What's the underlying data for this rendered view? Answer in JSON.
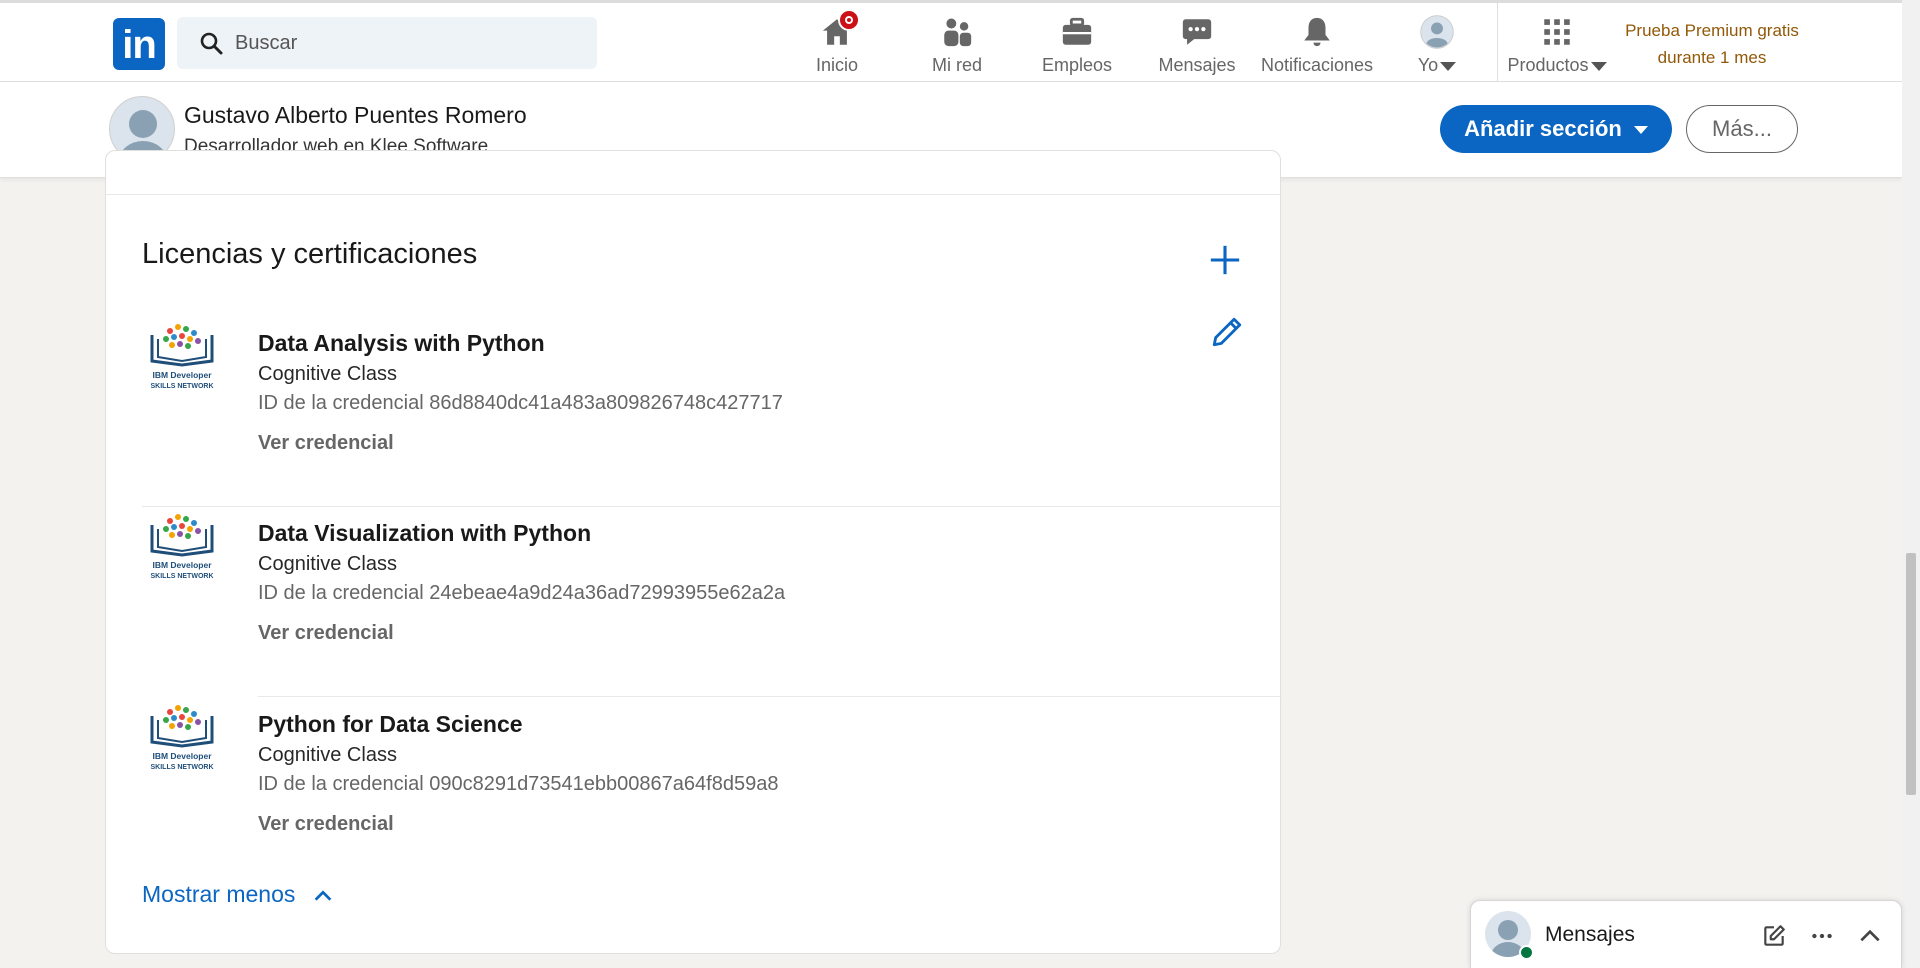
{
  "nav": {
    "search_placeholder": "Buscar",
    "items": [
      {
        "label": "Inicio",
        "icon": "home-icon"
      },
      {
        "label": "Mi red",
        "icon": "network-icon"
      },
      {
        "label": "Empleos",
        "icon": "briefcase-icon"
      },
      {
        "label": "Mensajes",
        "icon": "messaging-icon"
      },
      {
        "label": "Notificaciones",
        "icon": "bell-icon"
      },
      {
        "label": "Yo",
        "icon": "avatar"
      },
      {
        "label": "Productos",
        "icon": "grid-icon"
      }
    ],
    "premium_line1": "Prueba Premium gratis",
    "premium_line2": "durante 1 mes"
  },
  "profile": {
    "name": "Gustavo Alberto Puentes Romero",
    "headline": "Desarrollador web en Klee Software",
    "add_section_label": "Añadir sección",
    "more_label": "Más..."
  },
  "section": {
    "title": "Licencias y certificaciones",
    "certs": [
      {
        "title": "Data Analysis with Python",
        "issuer": "Cognitive Class",
        "credential": "ID de la credencial 86d8840dc41a483a809826748c427717",
        "view": "Ver credencial",
        "logo_line1": "IBM Developer",
        "logo_line2": "SKILLS NETWORK"
      },
      {
        "title": "Data Visualization with Python",
        "issuer": "Cognitive Class",
        "credential": "ID de la credencial 24ebeae4a9d24a36ad72993955e62a2a",
        "view": "Ver credencial",
        "logo_line1": "IBM Developer",
        "logo_line2": "SKILLS NETWORK"
      },
      {
        "title": "Python for Data Science",
        "issuer": "Cognitive Class",
        "credential": "ID de la credencial 090c8291d73541ebb00867a64f8d59a8",
        "view": "Ver credencial",
        "logo_line1": "IBM Developer",
        "logo_line2": "SKILLS NETWORK"
      }
    ],
    "show_less": "Mostrar menos"
  },
  "messaging": {
    "title": "Mensajes"
  },
  "colors": {
    "brand": "#0a66c2",
    "premium": "#915907",
    "notification": "#cc1016",
    "online": "#057642"
  }
}
